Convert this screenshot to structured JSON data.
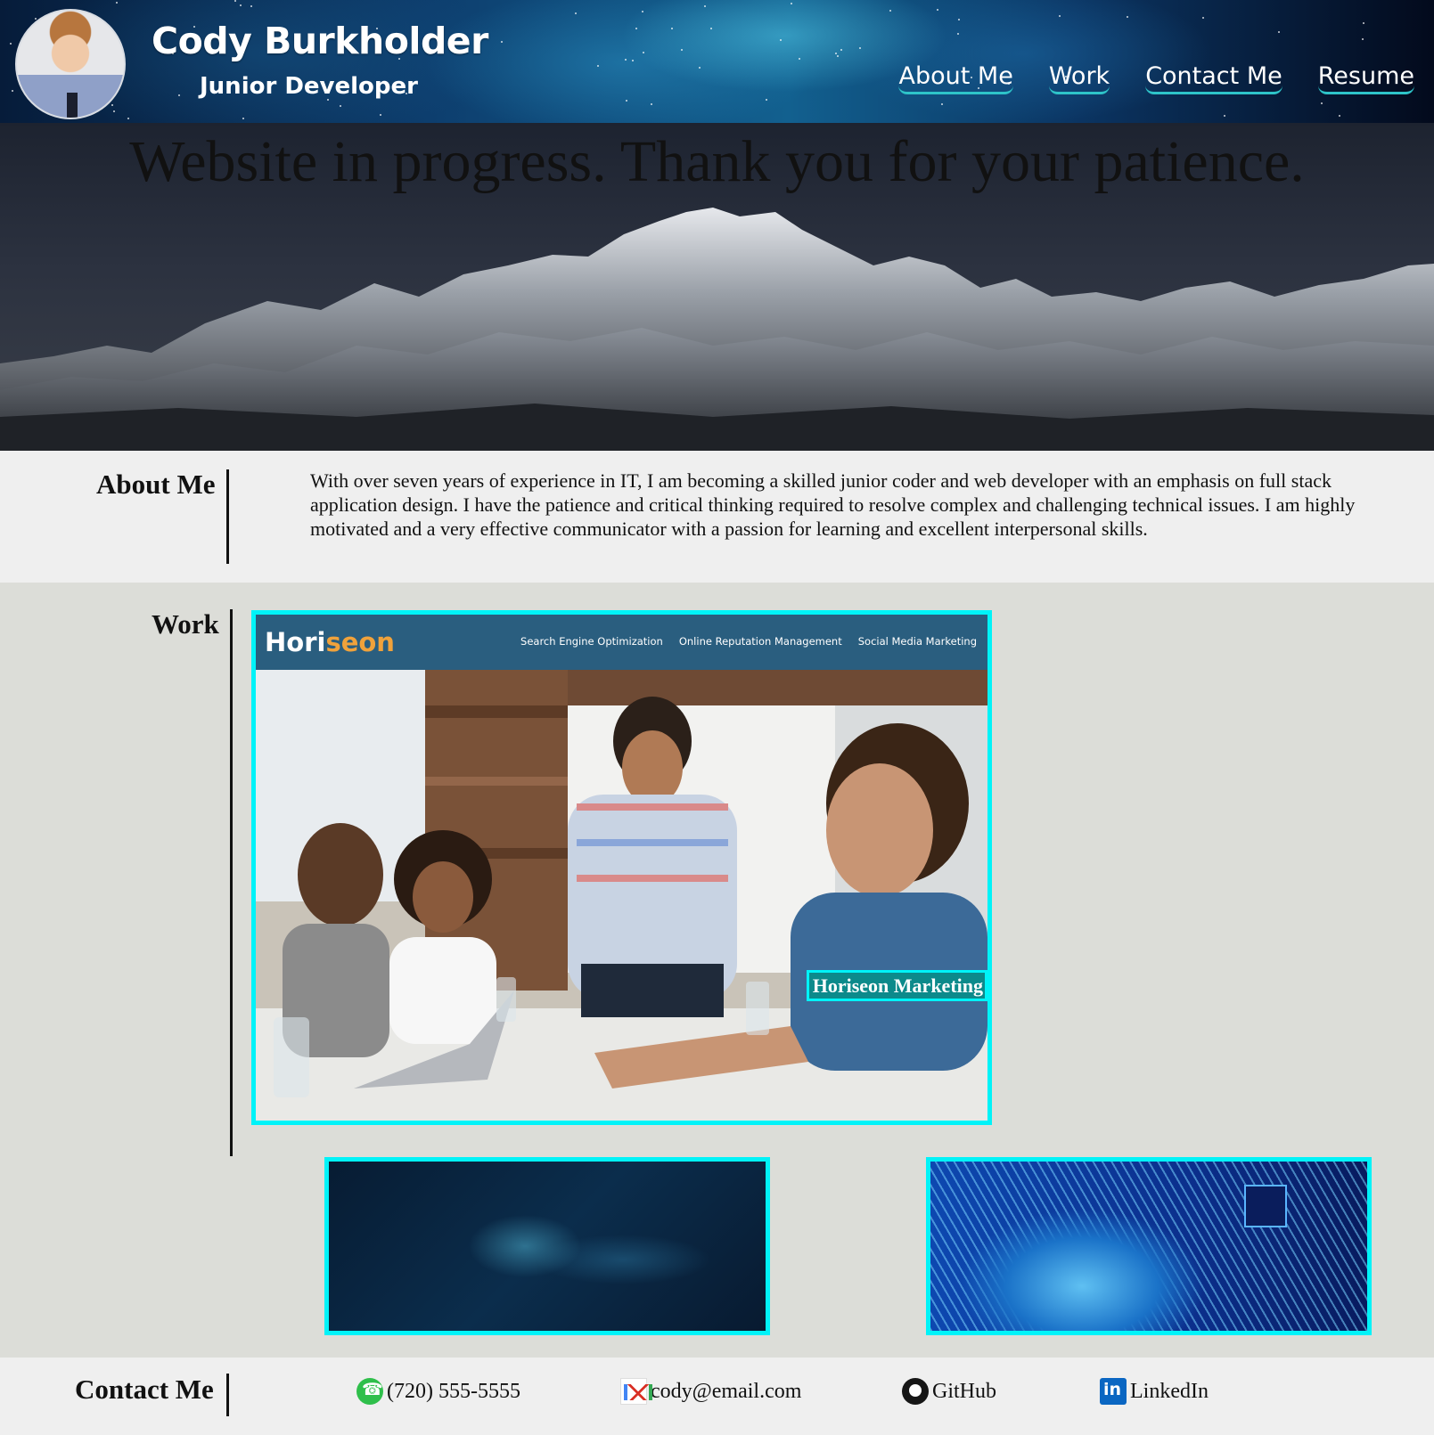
{
  "header": {
    "name": "Cody Burkholder",
    "role": "Junior Developer",
    "nav": [
      {
        "label": "About Me"
      },
      {
        "label": "Work"
      },
      {
        "label": "Contact Me"
      },
      {
        "label": "Resume"
      }
    ]
  },
  "hero": {
    "title": "Website in progress. Thank you for your patience."
  },
  "about": {
    "title": "About Me",
    "text": "With over seven years of experience in IT, I am becoming a skilled junior coder and web developer with an emphasis on full stack application design. I have the patience and critical thinking required to resolve complex and challenging technical issues. I am highly motivated and a very effective communicator with a passion for learning and excellent interpersonal skills."
  },
  "work": {
    "title": "Work",
    "featured": {
      "logo_part1": "Hori",
      "logo_part2": "seon",
      "links": [
        "Search Engine Optimization",
        "Online Reputation Management",
        "Social Media Marketing"
      ],
      "caption": "Horiseon Marketing"
    }
  },
  "contact": {
    "title": "Contact Me",
    "phone": "(720) 555-5555",
    "email": "cody@email.com",
    "github": "GitHub",
    "linkedin": "LinkedIn"
  },
  "colors": {
    "accent_cyan": "#00f3f8",
    "nav_underline": "#2ec4c9",
    "horiseon_bar": "#2a5e7f",
    "horiseon_orange": "#f0a23b",
    "caption_bg": "#0c8a8b"
  },
  "icons": [
    "phone-icon",
    "gmail-icon",
    "github-icon",
    "linkedin-icon"
  ]
}
